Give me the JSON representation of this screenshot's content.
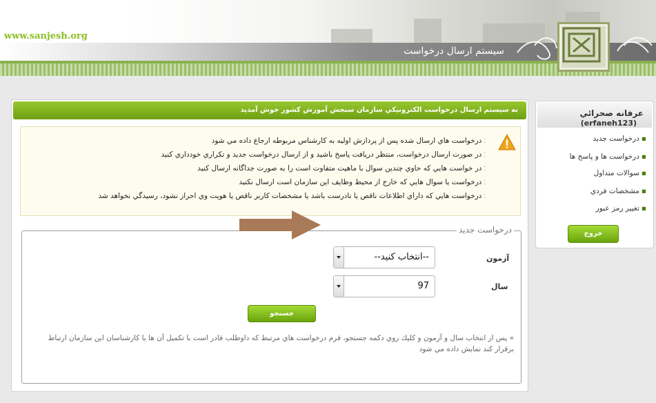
{
  "header": {
    "site_url": "www.sanjesh.org",
    "title": "سیستم ارسال درخواست"
  },
  "sidebar": {
    "user_name": "عرفانه صحرائي",
    "user_id": "(erfaneh123)",
    "items": [
      {
        "label": "درخواست جديد"
      },
      {
        "label": "درخواست ها و پاسخ ها"
      },
      {
        "label": "سوالات متداول"
      },
      {
        "label": "مشخصات فردي"
      },
      {
        "label": "تغيير رمز عبور"
      }
    ],
    "logout_label": "خروج"
  },
  "main": {
    "welcome": "به سيستم ارسال درخواست الكترونيكي سازمان سنجش آموزش كشور خوش آمديد",
    "notices": [
      "درخواست هاي ارسال شده پس از پردازش اوليه به كارشناس مربوطه ارجاع داده مي شود",
      "در صورت ارسال درخواست، منتظر دريافت پاسخ باشيد و از ارسال درخواست جديد و تكراري خودداري كنيد",
      "در خواست هايي كه حاوي چندين سوال با ماهيت متفاوت است را به صورت جداگانه ارسال كنيد",
      "درخواست يا سوال هايي كه خارج از محيط وظايف اين سازمان است ارسال نكنيد",
      "درخواست هايي كه داراي اطلاعات ناقص يا نادرست باشد يا مشخصات كاربر ناقص يا هويت وي احراز نشود، رسيدگي نخواهد شد"
    ],
    "form": {
      "legend": "درخواست جديد",
      "exam_label": "آزمون",
      "exam_value": "--انتخاب كنيد--",
      "year_label": "سال",
      "year_value": "97",
      "search_label": "جستجو",
      "help": "» پس از انتخاب سال و آزمون و كليك روي دكمه جستجو، فرم درخواست هاي مرتبط كه داوطلب قادر است با تكميل آن ها با كارشناسان اين سازمان ارتباط برقرار كند نمايش داده مي شود"
    }
  },
  "colors": {
    "accent_green": "#7cb518",
    "site_url_green": "#8cbf23",
    "arrow_brown": "#a97a57",
    "warning_orange": "#f0a419"
  }
}
